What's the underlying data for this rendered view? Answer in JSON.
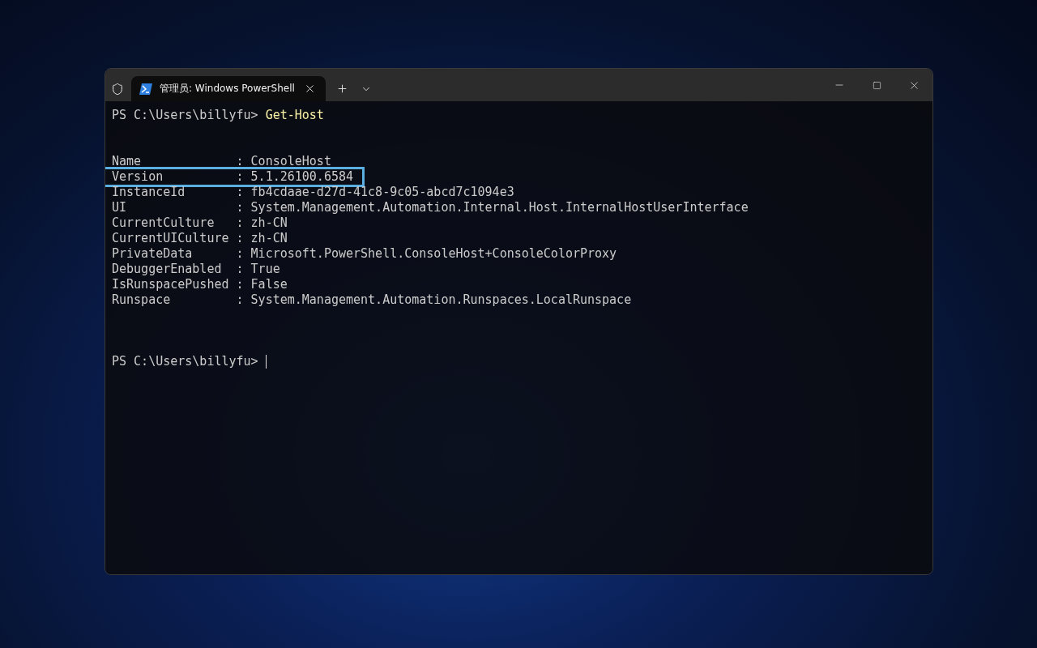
{
  "window": {
    "tabs": [
      {
        "title": "管理员: Windows PowerShell",
        "selected": true
      }
    ]
  },
  "terminal": {
    "lines": [
      {
        "kind": "prompt",
        "prompt": "PS C:\\Users\\billyfu>",
        "command": "Get-Host",
        "cursor": false
      },
      {
        "kind": "blank"
      },
      {
        "kind": "blank"
      },
      {
        "kind": "output",
        "text": "Name             : ConsoleHost",
        "highlighted": false
      },
      {
        "kind": "output",
        "text": "Version          : 5.1.26100.6584",
        "highlighted": true
      },
      {
        "kind": "output",
        "text": "InstanceId       : fb4cdaae-d27d-41c8-9c05-abcd7c1094e3",
        "highlighted": false
      },
      {
        "kind": "output",
        "text": "UI               : System.Management.Automation.Internal.Host.InternalHostUserInterface",
        "highlighted": false
      },
      {
        "kind": "output",
        "text": "CurrentCulture   : zh-CN",
        "highlighted": false
      },
      {
        "kind": "output",
        "text": "CurrentUICulture : zh-CN",
        "highlighted": false
      },
      {
        "kind": "output",
        "text": "PrivateData      : Microsoft.PowerShell.ConsoleHost+ConsoleColorProxy",
        "highlighted": false
      },
      {
        "kind": "output",
        "text": "DebuggerEnabled  : True",
        "highlighted": false
      },
      {
        "kind": "output",
        "text": "IsRunspacePushed : False",
        "highlighted": false
      },
      {
        "kind": "output",
        "text": "Runspace         : System.Management.Automation.Runspaces.LocalRunspace",
        "highlighted": false
      },
      {
        "kind": "blank"
      },
      {
        "kind": "blank"
      },
      {
        "kind": "blank"
      },
      {
        "kind": "prompt",
        "prompt": "PS C:\\Users\\billyfu>",
        "cursor": true
      }
    ]
  }
}
